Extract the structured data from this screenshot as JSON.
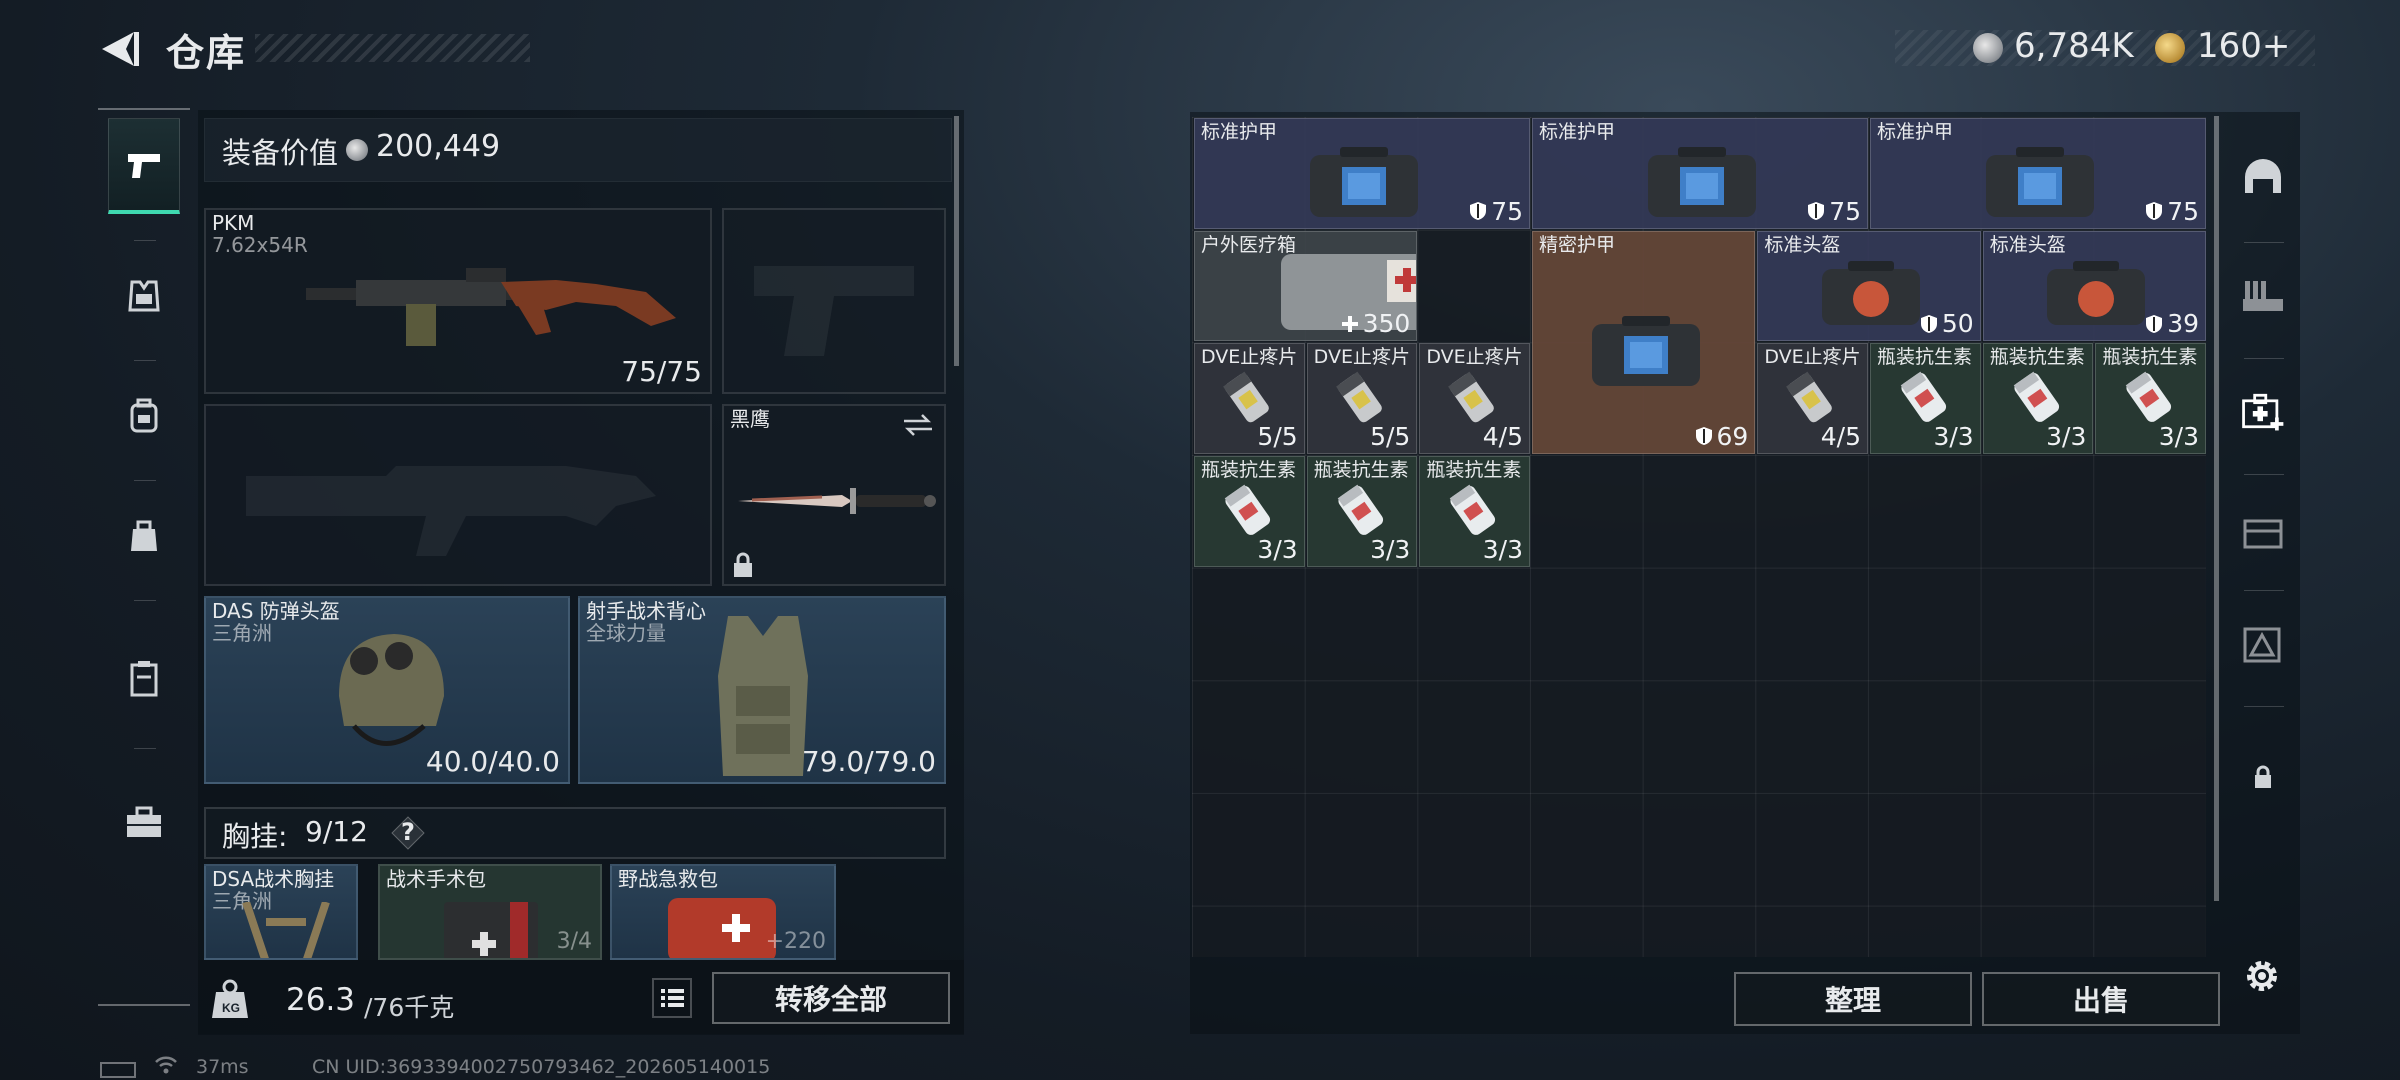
{
  "header": {
    "title": "仓库",
    "currency_silver": "6,784K",
    "currency_gold": "160+"
  },
  "loadout": {
    "equipment_value_label": "装备价值",
    "equipment_value": "200,449",
    "primary_weapon": {
      "name": "PKM",
      "caliber": "7.62x54R",
      "ammo": "75/75"
    },
    "melee": {
      "name": "黑鹰"
    },
    "helmet": {
      "name": "DAS 防弹头盔",
      "sub": "三角洲",
      "durability": "40.0/40.0"
    },
    "armor": {
      "name": "射手战术背心",
      "sub": "全球力量",
      "durability": "79.0/79.0"
    },
    "chest_rig_label": "胸挂:",
    "chest_rig_count": "9/12",
    "help_glyph": "?",
    "rig_items": [
      {
        "name": "DSA战术胸挂",
        "sub": "三角洲"
      },
      {
        "name": "战术手术包",
        "count": "3/4"
      },
      {
        "name": "野战急救包",
        "count": "+220"
      }
    ],
    "weight_value": "26.3",
    "weight_capacity": "/76千克",
    "transfer_all_label": "转移全部"
  },
  "stash": {
    "items": [
      {
        "name": "标准护甲",
        "stat": "75",
        "kind": "armor"
      },
      {
        "name": "标准护甲",
        "stat": "75",
        "kind": "armor"
      },
      {
        "name": "标准护甲",
        "stat": "75",
        "kind": "armor"
      },
      {
        "name": "户外医疗箱",
        "stat": "350",
        "kind": "med"
      },
      {
        "name": "精密护甲",
        "stat": "69",
        "kind": "rare"
      },
      {
        "name": "标准头盔",
        "stat": "50",
        "kind": "helmet"
      },
      {
        "name": "标准头盔",
        "stat": "39",
        "kind": "helmet"
      },
      {
        "name": "DVE止疼片",
        "stat": "5/5",
        "kind": "pill"
      },
      {
        "name": "DVE止疼片",
        "stat": "5/5",
        "kind": "pill"
      },
      {
        "name": "DVE止疼片",
        "stat": "4/5",
        "kind": "pill"
      },
      {
        "name": "DVE止疼片",
        "stat": "4/5",
        "kind": "pill"
      },
      {
        "name": "瓶装抗生素",
        "stat": "3/3",
        "kind": "anti"
      },
      {
        "name": "瓶装抗生素",
        "stat": "3/3",
        "kind": "anti"
      },
      {
        "name": "瓶装抗生素",
        "stat": "3/3",
        "kind": "anti"
      },
      {
        "name": "瓶装抗生素",
        "stat": "3/3",
        "kind": "anti"
      },
      {
        "name": "瓶装抗生素",
        "stat": "3/3",
        "kind": "anti"
      },
      {
        "name": "瓶装抗生素",
        "stat": "3/3",
        "kind": "anti"
      }
    ],
    "sort_label": "整理",
    "sell_label": "出售"
  },
  "status": {
    "ping": "37ms",
    "uid": "CN UID:3693394002750793462_202605140015"
  },
  "colors": {
    "accent_teal": "#3fd9b0",
    "armor_slot": "#343a58",
    "rare_slot": "#664838",
    "antibiotic_slot": "#283a34"
  }
}
